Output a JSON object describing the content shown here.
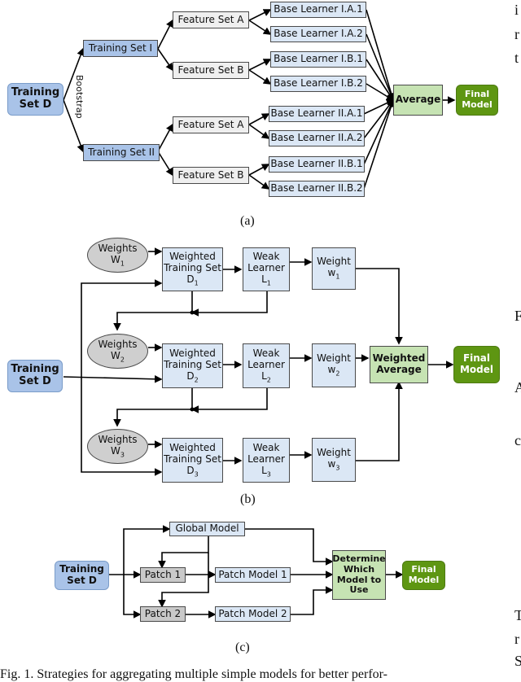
{
  "panel_a": {
    "label": "(a)",
    "training_set": "Training Set D",
    "bootstrap": "Bootstrap",
    "training_set_1": "Training Set I",
    "training_set_2": "Training Set II",
    "feature_sets": [
      "Feature Set A",
      "Feature Set B",
      "Feature Set A",
      "Feature Set B"
    ],
    "base_learners": [
      "Base Learner I.A.1",
      "Base Learner I.A.2",
      "Base Learner I.B.1",
      "Base Learner I.B.2",
      "Base Learner II.A.1",
      "Base Learner II.A.2",
      "Base Learner II.B.1",
      "Base Learner II.B.2"
    ],
    "average": "Average",
    "final_model": "Final Model"
  },
  "panel_b": {
    "label": "(b)",
    "training_set": "Training Set D",
    "rows": [
      {
        "weights": "Weights",
        "weights_sub": "1",
        "weighted_set": "Weighted Training Set D",
        "weighted_sub": "1",
        "learner": "Weak Learner L",
        "learner_sub": "1",
        "weight": "Weight w",
        "weight_sub": "1"
      },
      {
        "weights": "Weights",
        "weights_sub": "2",
        "weighted_set": "Weighted Training Set D",
        "weighted_sub": "2",
        "learner": "Weak Learner L",
        "learner_sub": "2",
        "weight": "Weight w",
        "weight_sub": "2"
      },
      {
        "weights": "Weights",
        "weights_sub": "3",
        "weighted_set": "Weighted Training Set D",
        "weighted_sub": "3",
        "learner": "Weak Learner L",
        "learner_sub": "3",
        "weight": "Weight w",
        "weight_sub": "3"
      }
    ],
    "weighted_average": "Weighted Average",
    "final_model": "Final Model"
  },
  "panel_c": {
    "label": "(c)",
    "training_set": "Training Set D",
    "global_model": "Global Model",
    "patch_1": "Patch 1",
    "patch_2": "Patch 2",
    "patch_model_1": "Patch Model 1",
    "patch_model_2": "Patch Model 2",
    "determine": "Determine Which Model to Use",
    "final_model": "Final Model"
  },
  "side_text": [
    "i",
    "r",
    "t",
    "F",
    "A",
    "c",
    "T",
    "r",
    "S"
  ],
  "caption": "Fig. 1.   Strategies for aggregating multiple simple models for better perfor-"
}
